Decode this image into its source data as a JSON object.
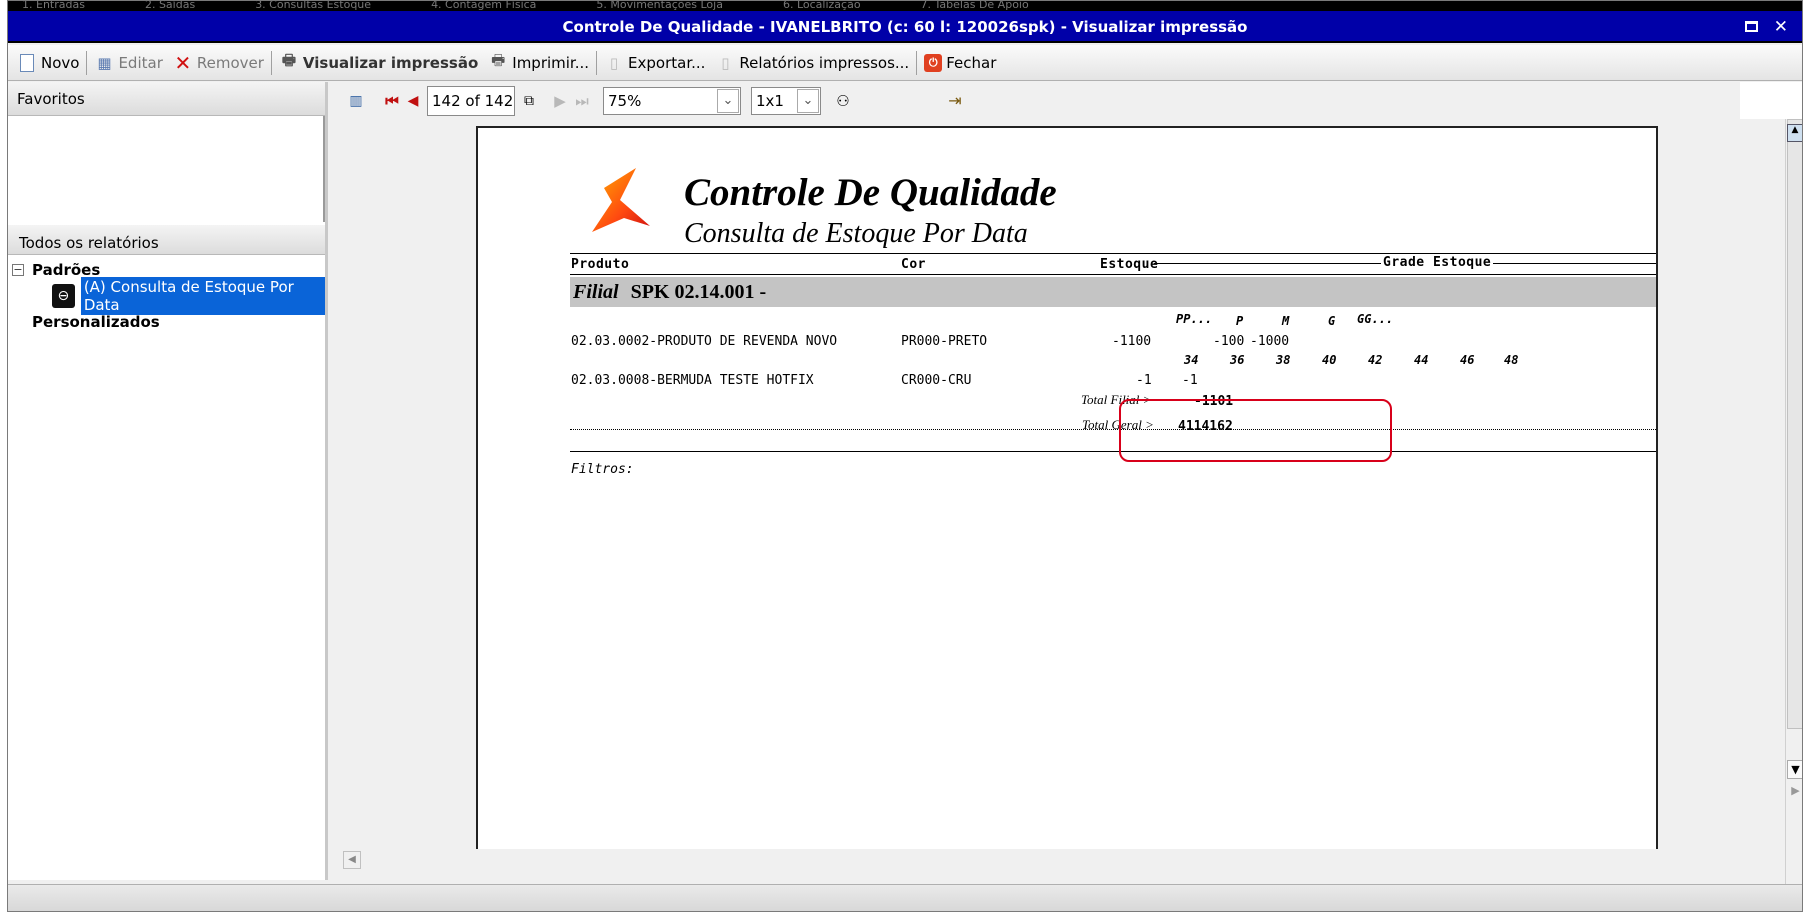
{
  "menu": [
    "1. Entradas",
    "2. Saídas",
    "3. Consultas Estoque",
    "4. Contagem Física",
    "5. Movimentações Loja",
    "6. Localização",
    "7. Tabelas De Apoio"
  ],
  "window": {
    "title": "Controle De Qualidade - IVANELBRITO (c: 60 l: 120026spk) - Visualizar impressão"
  },
  "toolbar": {
    "novo": "Novo",
    "editar": "Editar",
    "remover": "Remover",
    "visualizar": "Visualizar impressão",
    "imprimir": "Imprimir...",
    "exportar": "Exportar...",
    "relatorios": "Relatórios impressos...",
    "fechar": "Fechar"
  },
  "sidebar": {
    "favoritos": "Favoritos",
    "todos": "Todos os relatórios",
    "padroes": "Padrões",
    "report_item": "(A) Consulta de Estoque Por Data",
    "personalizados": "Personalizados"
  },
  "navigator": {
    "page": "142 of 142",
    "zoom": "75%",
    "layout": "1x1"
  },
  "report": {
    "title": "Controle De Qualidade",
    "subtitle": "Consulta de Estoque Por Data",
    "col_produto": "Produto",
    "col_cor": "Cor",
    "col_estoque": "Estoque",
    "col_grade": "Grade Estoque",
    "group_label": "Filial",
    "group_value": "SPK 02.14.001 -",
    "sizes_1": [
      "PP...",
      "P",
      "M",
      "G",
      "GG..."
    ],
    "rows": [
      {
        "produto": "02.03.0002-PRODUTO DE REVENDA NOVO",
        "cor": "PR000-PRETO",
        "estoque": "-1100",
        "grade": [
          "-100",
          "-1000"
        ]
      },
      {
        "produto": "02.03.0008-BERMUDA TESTE HOTFIX",
        "cor": "CR000-CRU",
        "estoque": "-1",
        "grade": [
          "-1"
        ]
      }
    ],
    "sizes_2": [
      "34",
      "36",
      "38",
      "40",
      "42",
      "44",
      "46",
      "48"
    ],
    "total_filial_label": "Total Filial >",
    "total_filial_value": "-1101",
    "total_geral_label": "Total Geral >",
    "total_geral_value": "4114162",
    "filtros": "Filtros:"
  },
  "colors": {
    "title_bar": "#0000a8",
    "selection": "#0a64d8",
    "highlight": "#d8001a",
    "band": "#c4c4c4"
  }
}
